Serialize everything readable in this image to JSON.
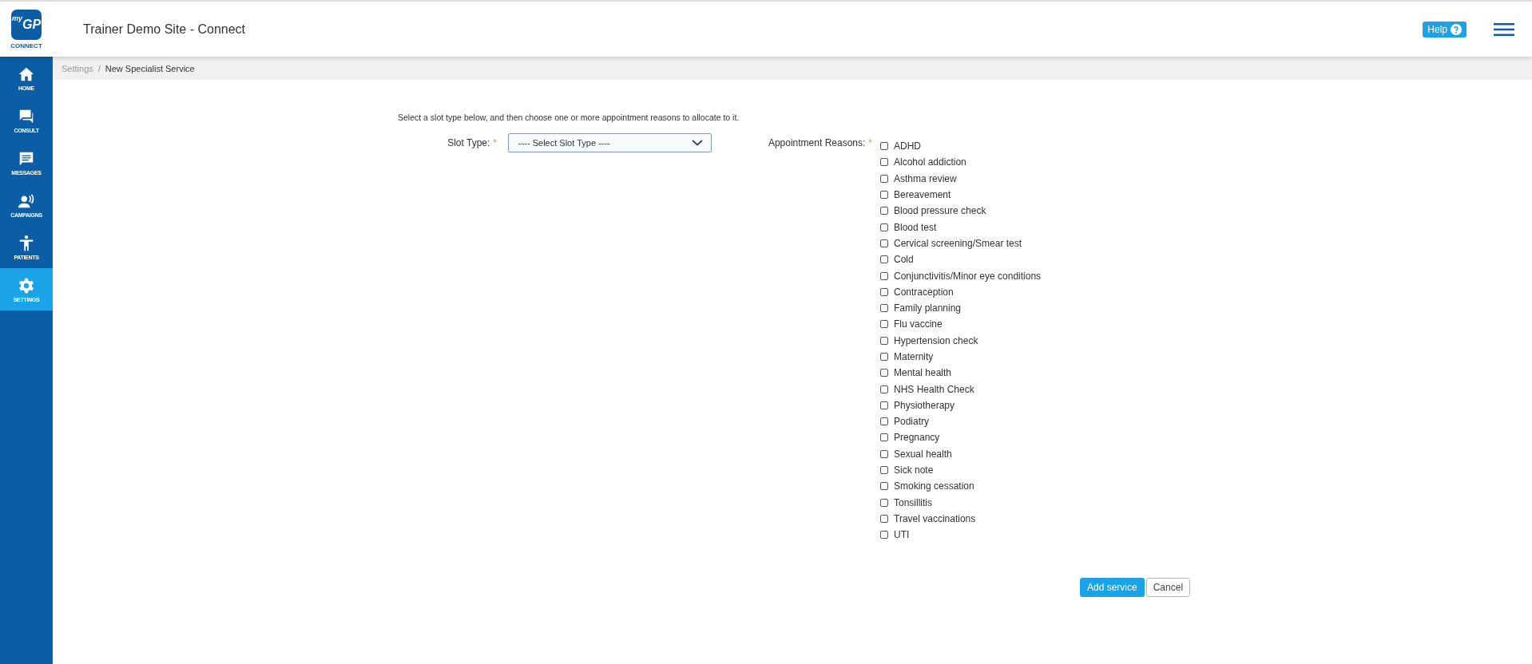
{
  "logo": {
    "prefix": "my",
    "mark": "GP",
    "caption": "CONNECT"
  },
  "header": {
    "title": "Trainer Demo Site - Connect",
    "help_button": "Help"
  },
  "sidebar": {
    "items": [
      {
        "kind": "home",
        "label": "HOME",
        "selected": false
      },
      {
        "kind": "consult",
        "label": "CONSULT",
        "selected": false
      },
      {
        "kind": "messages",
        "label": "MESSAGES",
        "selected": false
      },
      {
        "kind": "campaigns",
        "label": "CAMPAIGNS",
        "selected": false
      },
      {
        "kind": "patients",
        "label": "PATIENTS",
        "selected": false
      },
      {
        "kind": "settings",
        "label": "SETTINGS",
        "selected": true
      }
    ]
  },
  "breadcrumb": {
    "separator": "/",
    "items": [
      "Settings",
      "New Specialist Service"
    ]
  },
  "form": {
    "instruction": "Select a slot type below, and then choose one or more appointment reasons to allocate to it.",
    "slot_type": {
      "label": "Slot Type:",
      "required_mark": "*",
      "placeholder": "---- Select Slot Type ----"
    },
    "appointment_reasons": {
      "label": "Appointment Reasons:",
      "required_mark": "*",
      "options": [
        {
          "label": "ADHD",
          "checked": false
        },
        {
          "label": "Alcohol addiction",
          "checked": false
        },
        {
          "label": "Asthma review",
          "checked": false
        },
        {
          "label": "Bereavement",
          "checked": false
        },
        {
          "label": "Blood pressure check",
          "checked": false
        },
        {
          "label": "Blood test",
          "checked": false
        },
        {
          "label": "Cervical screening/Smear test",
          "checked": false
        },
        {
          "label": "Cold",
          "checked": false
        },
        {
          "label": "Conjunctivitis/Minor eye conditions",
          "checked": false
        },
        {
          "label": "Contraception",
          "checked": false
        },
        {
          "label": "Family planning",
          "checked": false
        },
        {
          "label": "Flu vaccine",
          "checked": false
        },
        {
          "label": "Hypertension check",
          "checked": false
        },
        {
          "label": "Maternity",
          "checked": false
        },
        {
          "label": "Mental health",
          "checked": false
        },
        {
          "label": "NHS Health Check",
          "checked": false
        },
        {
          "label": "Physiotherapy",
          "checked": false
        },
        {
          "label": "Podiatry",
          "checked": false
        },
        {
          "label": "Pregnancy",
          "checked": false
        },
        {
          "label": "Sexual health",
          "checked": false
        },
        {
          "label": "Sick note",
          "checked": false
        },
        {
          "label": "Smoking cessation",
          "checked": false
        },
        {
          "label": "Tonsillitis",
          "checked": false
        },
        {
          "label": "Travel vaccinations",
          "checked": false
        },
        {
          "label": "UTI",
          "checked": false
        }
      ]
    },
    "buttons": {
      "primary": "Add service",
      "secondary": "Cancel"
    }
  }
}
